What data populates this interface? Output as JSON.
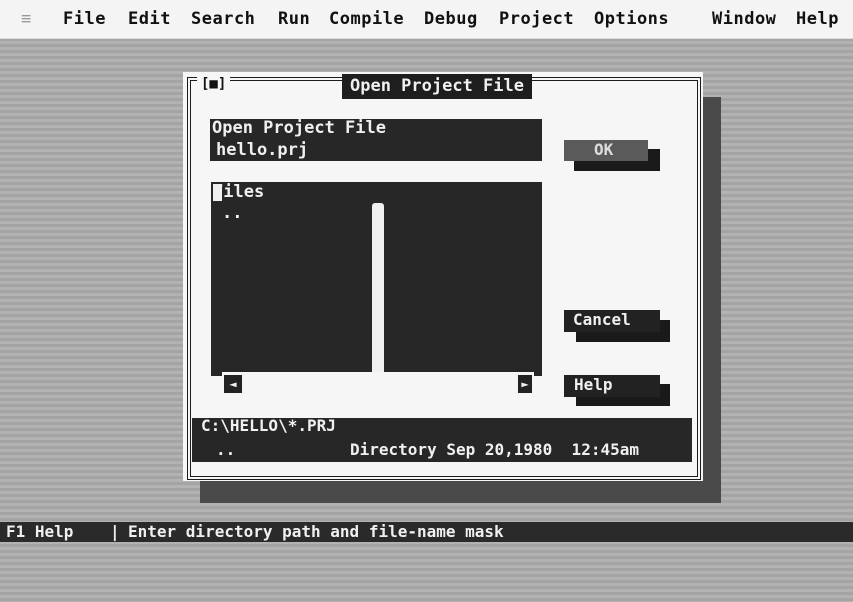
{
  "menubar": {
    "system_icon": "≡",
    "items": [
      "File",
      "Edit",
      "Search",
      "Run",
      "Compile",
      "Debug",
      "Project",
      "Options",
      "Window",
      "Help"
    ]
  },
  "dialog": {
    "close_icon": "[■]",
    "title": "Open Project File",
    "input_label": "Open Project File",
    "input_value": "hello.prj",
    "files_label": "Files",
    "files": [
      ".."
    ],
    "buttons": {
      "ok": "OK",
      "cancel": "Cancel",
      "help": "Help"
    },
    "scroll_left_icon": "◄",
    "scroll_right_icon": "►",
    "info": {
      "path": "C:\\HELLO\\*.PRJ",
      "selected": "..",
      "description": "Directory Sep 20,1980  12:45am"
    }
  },
  "statusbar": {
    "key": "F1 Help",
    "separator": "|",
    "message": "Enter directory path and file-name mask"
  },
  "colors": {
    "desktop": "#ababab",
    "menubar": "#f4f4f4",
    "dialog": "#f6f6f6",
    "panel": "#272727"
  }
}
